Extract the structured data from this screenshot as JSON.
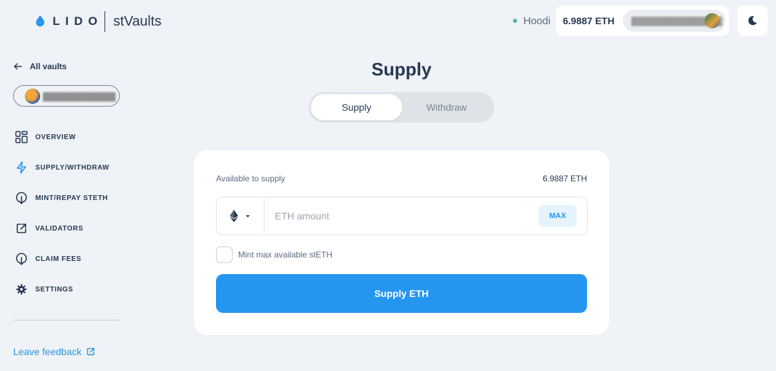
{
  "header": {
    "logo_text": "LIDO",
    "app_name": "stVaults",
    "network": {
      "name": "Hoodi",
      "status_color": "#53ba95"
    },
    "wallet": {
      "balance": "6.9887 ETH"
    },
    "theme_icon": "moon-icon"
  },
  "sidebar": {
    "back_label": "All vaults",
    "nav": [
      {
        "label": "OVERVIEW",
        "icon": "grid-icon"
      },
      {
        "label": "SUPPLY/WITHDRAW",
        "icon": "lightning-icon",
        "active": true
      },
      {
        "label": "MINT/REPAY STETH",
        "icon": "mint-icon"
      },
      {
        "label": "VALIDATORS",
        "icon": "external-icon"
      },
      {
        "label": "CLAIM FEES",
        "icon": "claim-icon"
      },
      {
        "label": "SETTINGS",
        "icon": "gear-icon"
      }
    ],
    "feedback_label": "Leave feedback"
  },
  "main": {
    "title": "Supply",
    "tabs": [
      {
        "label": "Supply",
        "active": true
      },
      {
        "label": "Withdraw",
        "active": false
      }
    ],
    "card": {
      "available_label": "Available to supply",
      "available_value": "6.9887 ETH",
      "amount_placeholder": "ETH amount",
      "max_label": "MAX",
      "checkbox_label": "Mint max available stETH",
      "submit_label": "Supply ETH"
    }
  },
  "colors": {
    "accent": "#2596f0",
    "background": "#eff2f6",
    "text": "#273852"
  }
}
